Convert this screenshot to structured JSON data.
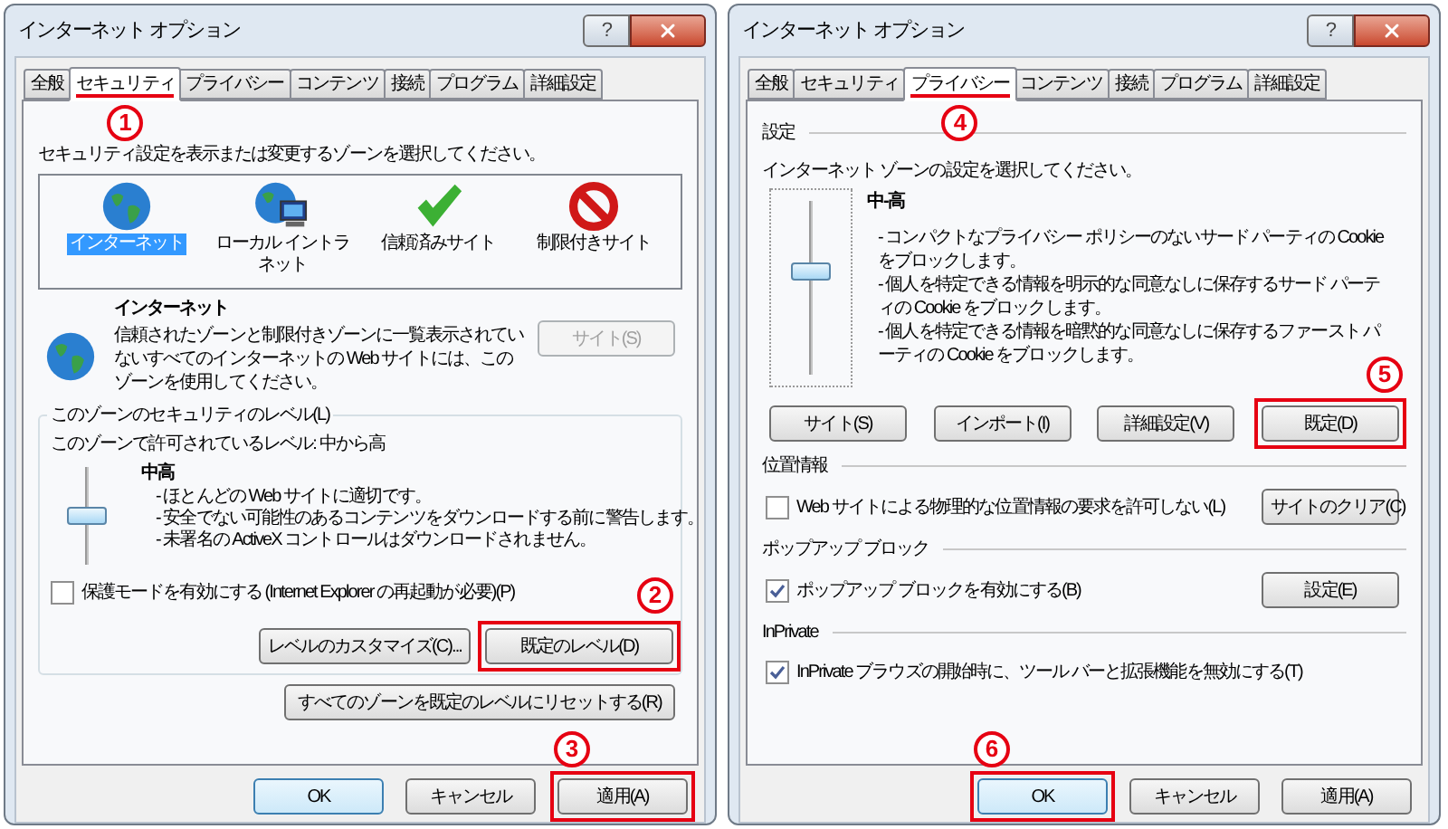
{
  "dialogs": [
    {
      "kind": "security",
      "title": "インターネット オプション",
      "help_button": "?",
      "tabs": [
        {
          "label": "全般",
          "selected": false
        },
        {
          "label": "セキュリティ",
          "selected": true,
          "callout": "1"
        },
        {
          "label": "プライバシー",
          "selected": false
        },
        {
          "label": "コンテンツ",
          "selected": false
        },
        {
          "label": "接続",
          "selected": false
        },
        {
          "label": "プログラム",
          "selected": false
        },
        {
          "label": "詳細設定",
          "selected": false
        }
      ],
      "zone_prompt": "セキュリティ設定を表示または変更するゾーンを選択してください。",
      "zones": [
        {
          "kind": "internet",
          "label": "インターネット",
          "selected": true
        },
        {
          "kind": "intranet",
          "label": "ローカル イントラネット",
          "selected": false
        },
        {
          "kind": "trusted",
          "label": "信頼済みサイト",
          "selected": false
        },
        {
          "kind": "restricted",
          "label": "制限付きサイト",
          "selected": false
        }
      ],
      "zone_detail": {
        "title": "インターネット",
        "description": "信頼されたゾーンと制限付きゾーンに一覧表示されていないすべてのインターネットの Web サイトには、このゾーンを使用してください。",
        "button": {
          "label": "サイト(S)",
          "disabled": true
        }
      },
      "level_group": {
        "legend": "このゾーンのセキュリティのレベル(L)",
        "allowed": "このゾーンで許可されているレベル: 中から高",
        "level": 0.5,
        "level_name": "中高",
        "bullets": [
          "- ほとんどの Web サイトに適切です。",
          "- 安全でない可能性のあるコンテンツをダウンロードする前に警告します。",
          "- 未署名の ActiveX コントロールはダウンロードされません。"
        ],
        "checkbox": {
          "label": "保護モードを有効にする (Internet Explorer の再起動が必要)(P)",
          "checked": false
        },
        "buttons": [
          {
            "label": "レベルのカスタマイズ(C)..."
          },
          {
            "label": "既定のレベル(D)",
            "highlighted": true,
            "callout": "2"
          }
        ]
      },
      "reset_button": {
        "label": "すべてのゾーンを既定のレベルにリセットする(R)"
      },
      "footer": [
        {
          "label": "OK",
          "default": true
        },
        {
          "label": "キャンセル"
        },
        {
          "label": "適用(A)",
          "highlighted": true,
          "callout": "3"
        }
      ]
    },
    {
      "kind": "privacy",
      "title": "インターネット オプション",
      "help_button": "?",
      "tabs": [
        {
          "label": "全般",
          "selected": false
        },
        {
          "label": "セキュリティ",
          "selected": false
        },
        {
          "label": "プライバシー",
          "selected": true,
          "callout": "4"
        },
        {
          "label": "コンテンツ",
          "selected": false
        },
        {
          "label": "接続",
          "selected": false
        },
        {
          "label": "プログラム",
          "selected": false
        },
        {
          "label": "詳細設定",
          "selected": false
        }
      ],
      "settings": {
        "heading": "設定",
        "prompt": "インターネット ゾーンの設定を選択してください。",
        "level": 0.6,
        "level_name": "中-高",
        "bullets": [
          "- コンパクトなプライバシー ポリシーのないサード パーティの Cookie をブロックします。",
          "- 個人を特定できる情報を明示的な同意なしに保存するサード パーティの Cookie をブロックします。",
          "- 個人を特定できる情報を暗黙的な同意なしに保存するファースト パーティの Cookie をブロックします。"
        ],
        "buttons": [
          {
            "label": "サイト(S)"
          },
          {
            "label": "インポート(I)"
          },
          {
            "label": "詳細設定(V)"
          },
          {
            "label": "既定(D)",
            "highlighted": true,
            "callout": "5"
          }
        ]
      },
      "sections": [
        {
          "heading": "位置情報",
          "checkbox": {
            "label": "Web サイトによる物理的な位置情報の要求を許可しない(L)",
            "checked": false
          },
          "button": {
            "label": "サイトのクリア(C)"
          }
        },
        {
          "heading": "ポップアップ ブロック",
          "checkbox": {
            "label": "ポップアップ ブロックを有効にする(B)",
            "checked": true
          },
          "button": {
            "label": "設定(E)"
          }
        },
        {
          "heading": "InPrivate",
          "checkbox": {
            "label": "InPrivate ブラウズの開始時に、ツール バーと拡張機能を無効にする(T)",
            "checked": true
          }
        }
      ],
      "footer": [
        {
          "label": "OK",
          "default": true,
          "highlighted": true,
          "callout": "6"
        },
        {
          "label": "キャンセル"
        },
        {
          "label": "適用(A)"
        }
      ]
    }
  ]
}
